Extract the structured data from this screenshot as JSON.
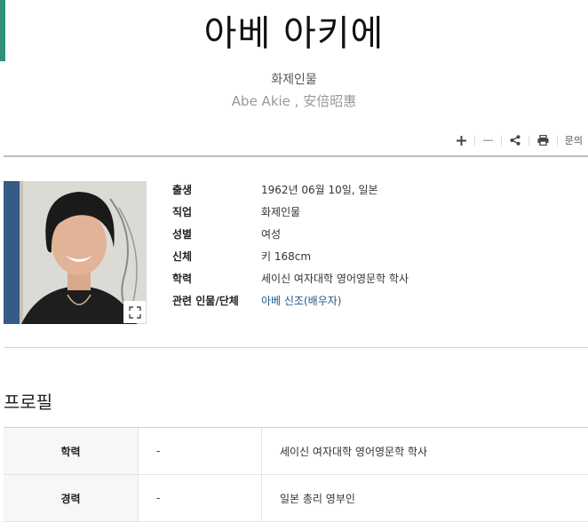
{
  "header": {
    "title": "아베 아키에",
    "subtitle": "화제인물",
    "alias": "Abe Akie , 安倍昭惠"
  },
  "toolbar": {
    "zoom_in_icon": "plus-icon",
    "zoom_out_icon": "minus-icon",
    "share_icon": "share-icon",
    "print_icon": "print-icon",
    "inquiry_label": "문의"
  },
  "profile_photo": {
    "expand_icon": "expand-icon"
  },
  "info": {
    "rows": [
      {
        "label": "출생",
        "value": "1962년 06월 10일, 일본"
      },
      {
        "label": "직업",
        "value": "화제인물"
      },
      {
        "label": "성별",
        "value": "여성"
      },
      {
        "label": "신체",
        "value": "키 168cm"
      },
      {
        "label": "학력",
        "value": "세이신 여자대학 영어영문학 학사"
      },
      {
        "label": "관련 인물/단체",
        "value": "아베 신조(배우자)"
      }
    ]
  },
  "profile_section": {
    "title": "프로필",
    "rows": [
      {
        "head": "학력",
        "mid": "-",
        "value": "세이신 여자대학 영어영문학 학사"
      },
      {
        "head": "경력",
        "mid": "-",
        "value": "일본 총리 영부인"
      }
    ]
  },
  "colors": {
    "accent": "#2f8f79",
    "link": "#215a8a"
  }
}
